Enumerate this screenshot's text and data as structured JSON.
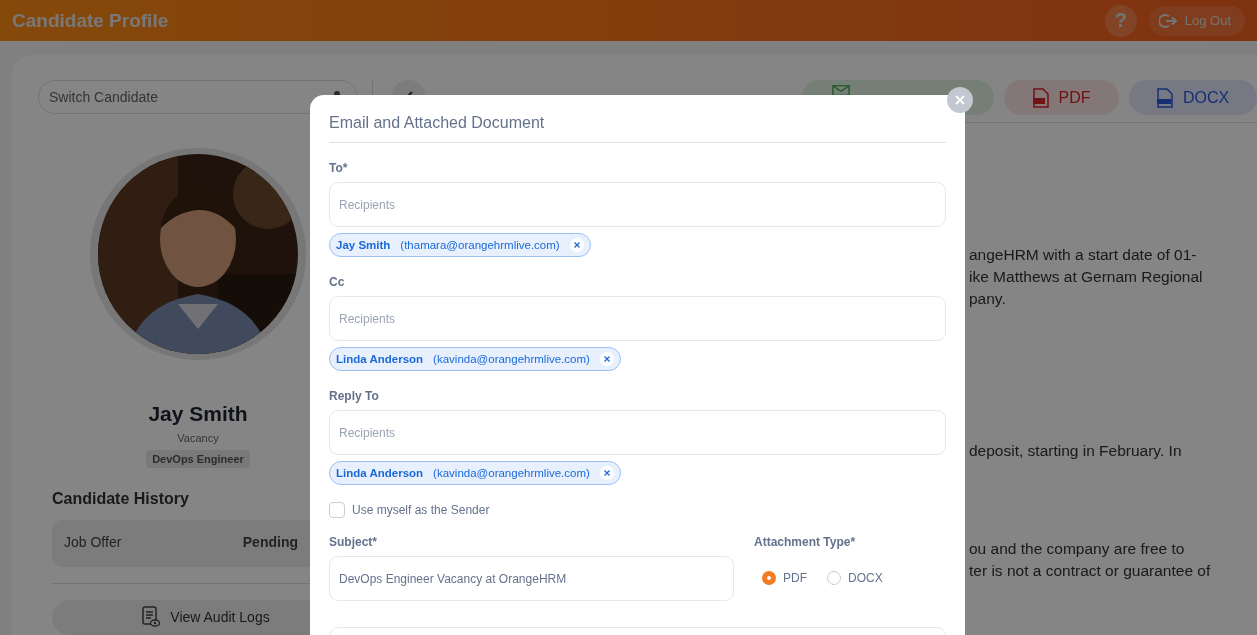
{
  "header": {
    "title": "Candidate Profile",
    "help": "?",
    "logout": "Log Out"
  },
  "switcher": {
    "placeholder": "Switch Candidate"
  },
  "candidate": {
    "name": "Jay Smith",
    "vacancy_label": "Vacancy",
    "vacancy": "DevOps Engineer"
  },
  "history": {
    "title": "Candidate History",
    "rows": [
      {
        "stage": "Job Offer",
        "status": "Pending"
      }
    ],
    "audit_button": "View Audit Logs"
  },
  "document": {
    "actions": [
      {
        "kind": "email"
      },
      {
        "kind": "pdf",
        "label": "PDF"
      },
      {
        "kind": "docx",
        "label": "DOCX"
      }
    ],
    "paragraphs": [
      [
        "angeHRM with a start date of 01-",
        "ike Matthews at Gernam Regional",
        "pany."
      ],
      [
        "deposit, starting in February. In"
      ],
      [
        "ou and the company are free to",
        "ter is not a contract or guarantee of"
      ]
    ]
  },
  "modal": {
    "title": "Email and Attached Document",
    "recipient_fields": [
      {
        "label": "To*",
        "placeholder": "Recipients",
        "chips": [
          {
            "name": "Jay Smith",
            "email": "(thamara@orangehrmlive.com)"
          }
        ]
      },
      {
        "label": "Cc",
        "placeholder": "Recipients",
        "chips": [
          {
            "name": "Linda Anderson",
            "email": "(kavinda@orangehrmlive.com)"
          }
        ]
      },
      {
        "label": "Reply To",
        "placeholder": "Recipients",
        "chips": [
          {
            "name": "Linda Anderson",
            "email": "(kavinda@orangehrmlive.com)"
          }
        ]
      }
    ],
    "use_myself": {
      "label": "Use myself as the Sender",
      "checked": false
    },
    "subject": {
      "label": "Subject*",
      "value": "DevOps Engineer Vacancy at OrangeHRM"
    },
    "attachment_type": {
      "label": "Attachment Type*",
      "options": [
        {
          "label": "PDF",
          "selected": true
        },
        {
          "label": "DOCX",
          "selected": false
        }
      ]
    }
  }
}
